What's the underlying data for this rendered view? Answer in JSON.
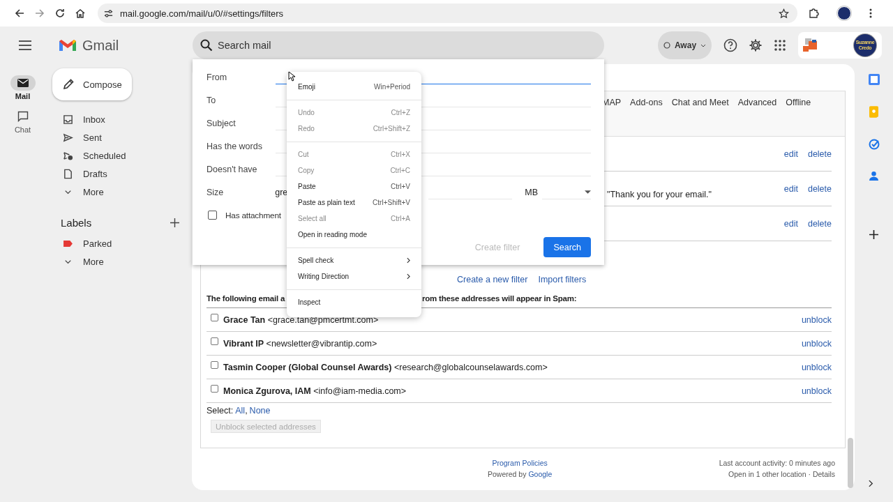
{
  "browser": {
    "url": "mail.google.com/mail/u/0/#settings/filters"
  },
  "header": {
    "app_name": "Gmail",
    "search_placeholder": "Search mail",
    "status": "Away",
    "account_badge": "Suzanne Credo"
  },
  "rail": [
    {
      "label": "Mail",
      "kind": "mail",
      "selected": true
    },
    {
      "label": "Chat",
      "kind": "chat",
      "selected": false
    }
  ],
  "compose": "Compose",
  "nav": [
    {
      "label": "Inbox",
      "kind": "inbox"
    },
    {
      "label": "Sent",
      "kind": "sent"
    },
    {
      "label": "Scheduled",
      "kind": "scheduled"
    },
    {
      "label": "Drafts",
      "kind": "drafts"
    },
    {
      "label": "More",
      "kind": "more"
    }
  ],
  "labels": {
    "title": "Labels",
    "items": [
      {
        "label": "Parked",
        "kind": "label",
        "color": "#e53935"
      },
      {
        "label": "More",
        "kind": "more"
      }
    ]
  },
  "settings_tabs": [
    "MAP",
    "Add-ons",
    "Chat and Meet",
    "Advanced",
    "Offline"
  ],
  "filters": [
    {
      "actions": [
        "edit",
        "delete"
      ]
    },
    {
      "criteria": "\"Thank you for your email.\"",
      "actions": [
        "edit",
        "delete"
      ]
    },
    {
      "actions": [
        "edit",
        "delete"
      ]
    }
  ],
  "filter_links": [
    "Create a new filter",
    "Import filters"
  ],
  "blocked": {
    "heading_parts": [
      "The following email a",
      "rom these addresses will appear in Spam:"
    ],
    "rows": [
      {
        "name": "Grace Tan",
        "email": "<grace.tan@pmcertmt.com>",
        "checked": false,
        "action": "unblock"
      },
      {
        "name": "Vibrant IP",
        "email": "<newsletter@vibrantip.com>",
        "checked": false,
        "action": "unblock"
      },
      {
        "name": "Tasmin Cooper (Global Counsel Awards)",
        "email": "<research@globalcounselawards.com>",
        "checked": false,
        "action": "unblock"
      },
      {
        "name": "Monica Zgurova, IAM",
        "email": "<info@iam-media.com>",
        "checked": false,
        "action": "unblock"
      }
    ],
    "select": {
      "label": "Select:",
      "options": [
        "All",
        "None"
      ],
      "separator": ","
    },
    "unblock_button": {
      "label": "Unblock selected addresses",
      "disabled": true
    }
  },
  "footer": {
    "policies": "Program Policies",
    "powered_by": "Powered by",
    "powered_link": "Google",
    "activity": "Last account activity: 0 minutes ago",
    "other_location": "Open in 1 other location",
    "separator": "·",
    "details": "Details"
  },
  "search_panel": {
    "fields": [
      {
        "label": "From",
        "kind": "text",
        "focused": true
      },
      {
        "label": "To",
        "kind": "text",
        "focused": false
      },
      {
        "label": "Subject",
        "kind": "text",
        "focused": false
      },
      {
        "label": "Has the words",
        "kind": "text",
        "focused": false
      },
      {
        "label": "Doesn't have",
        "kind": "text",
        "focused": false
      },
      {
        "label": "Size",
        "kind": "size",
        "operator": "gre",
        "unit": "MB",
        "focused": false
      }
    ],
    "checkbox": {
      "label": "Has attachment",
      "checked": false
    },
    "buttons": [
      {
        "label": "Create filter",
        "disabled": true
      },
      {
        "label": "Search",
        "disabled": false
      }
    ]
  },
  "context_menu": [
    {
      "kind": "item",
      "label": "Emoji",
      "shortcut": "Win+Period",
      "disabled": false
    },
    {
      "kind": "separator"
    },
    {
      "kind": "item",
      "label": "Undo",
      "shortcut": "Ctrl+Z",
      "disabled": true
    },
    {
      "kind": "item",
      "label": "Redo",
      "shortcut": "Ctrl+Shift+Z",
      "disabled": true
    },
    {
      "kind": "separator"
    },
    {
      "kind": "item",
      "label": "Cut",
      "shortcut": "Ctrl+X",
      "disabled": true
    },
    {
      "kind": "item",
      "label": "Copy",
      "shortcut": "Ctrl+C",
      "disabled": true
    },
    {
      "kind": "item",
      "label": "Paste",
      "shortcut": "Ctrl+V",
      "disabled": false
    },
    {
      "kind": "item",
      "label": "Paste as plain text",
      "shortcut": "Ctrl+Shift+V",
      "disabled": false
    },
    {
      "kind": "item",
      "label": "Select all",
      "shortcut": "Ctrl+A",
      "disabled": true
    },
    {
      "kind": "item",
      "label": "Open in reading mode",
      "disabled": false
    },
    {
      "kind": "separator"
    },
    {
      "kind": "submenu",
      "label": "Spell check",
      "disabled": false
    },
    {
      "kind": "submenu",
      "label": "Writing Direction",
      "disabled": false
    },
    {
      "kind": "separator"
    },
    {
      "kind": "item",
      "label": "Inspect",
      "disabled": false
    }
  ]
}
